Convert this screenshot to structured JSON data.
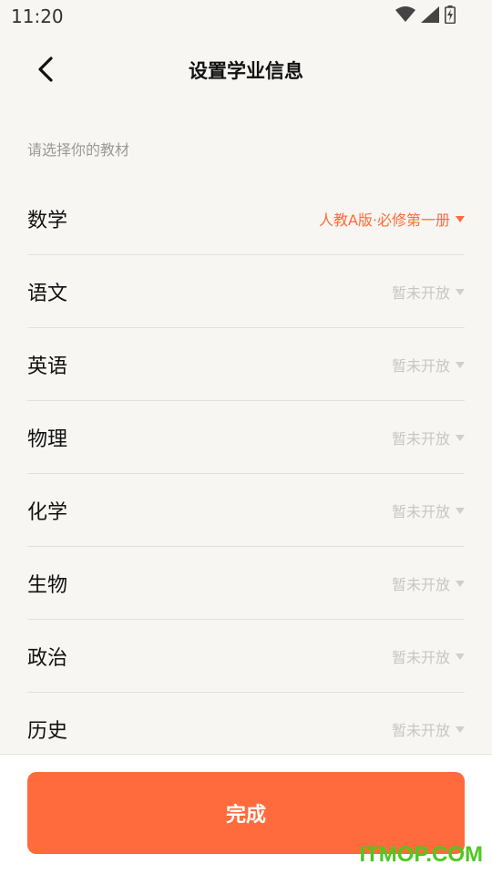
{
  "status_bar": {
    "time": "11:20",
    "icons": [
      "wifi-icon",
      "cell-signal-icon",
      "battery-icon"
    ]
  },
  "header": {
    "title": "设置学业信息",
    "back_icon": "chevron-left-icon"
  },
  "hint": "请选择你的教材",
  "subjects": [
    {
      "name": "数学",
      "value": "人教A版·必修第一册",
      "active": true
    },
    {
      "name": "语文",
      "value": "暂未开放",
      "active": false
    },
    {
      "name": "英语",
      "value": "暂未开放",
      "active": false
    },
    {
      "name": "物理",
      "value": "暂未开放",
      "active": false
    },
    {
      "name": "化学",
      "value": "暂未开放",
      "active": false
    },
    {
      "name": "生物",
      "value": "暂未开放",
      "active": false
    },
    {
      "name": "政治",
      "value": "暂未开放",
      "active": false
    },
    {
      "name": "历史",
      "value": "暂未开放",
      "active": false
    }
  ],
  "done_button": "完成",
  "watermark": "ITMOP.COM",
  "colors": {
    "accent": "#ff6b3d",
    "disabled_text": "#c6c6c6",
    "background": "#f7f6f2",
    "watermark": "#4cc81f"
  }
}
